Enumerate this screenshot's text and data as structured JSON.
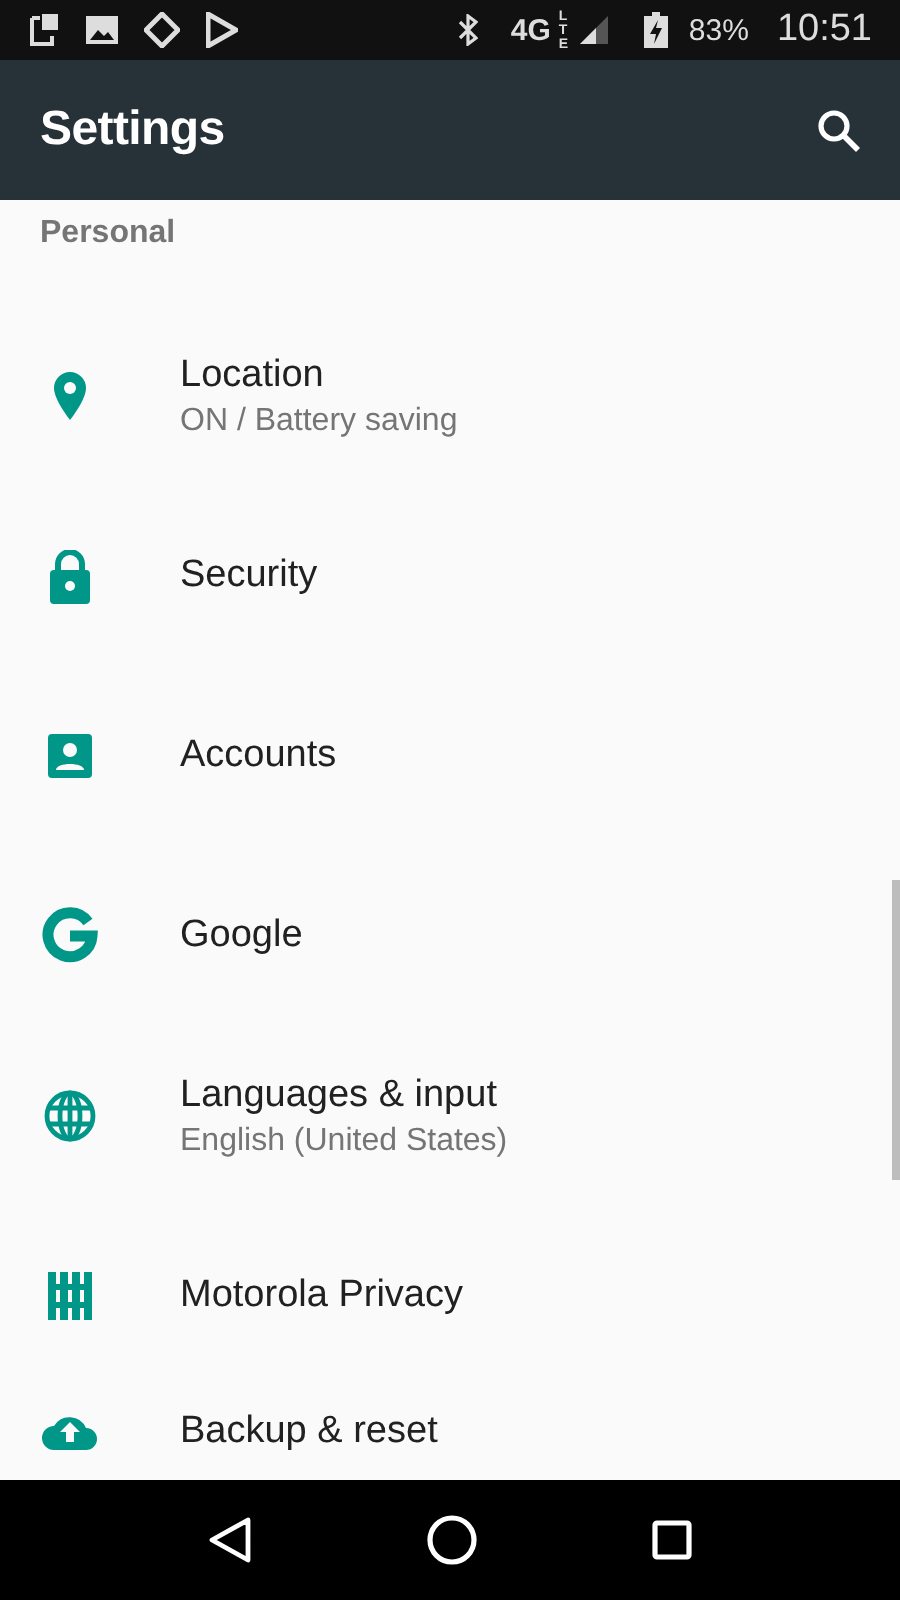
{
  "status_bar": {
    "network": "4G",
    "network_sub": "LTE",
    "battery": "83%",
    "time": "10:51"
  },
  "app_bar": {
    "title": "Settings"
  },
  "section": {
    "title": "Personal"
  },
  "items": [
    {
      "kind": "location",
      "title": "Location",
      "subtitle": "ON / Battery saving"
    },
    {
      "kind": "security",
      "title": "Security"
    },
    {
      "kind": "accounts",
      "title": "Accounts"
    },
    {
      "kind": "google",
      "title": "Google"
    },
    {
      "kind": "languages",
      "title": "Languages & input",
      "subtitle": "English (United States)"
    },
    {
      "kind": "privacy",
      "title": "Motorola Privacy"
    },
    {
      "kind": "backup",
      "title": "Backup & reset"
    }
  ]
}
